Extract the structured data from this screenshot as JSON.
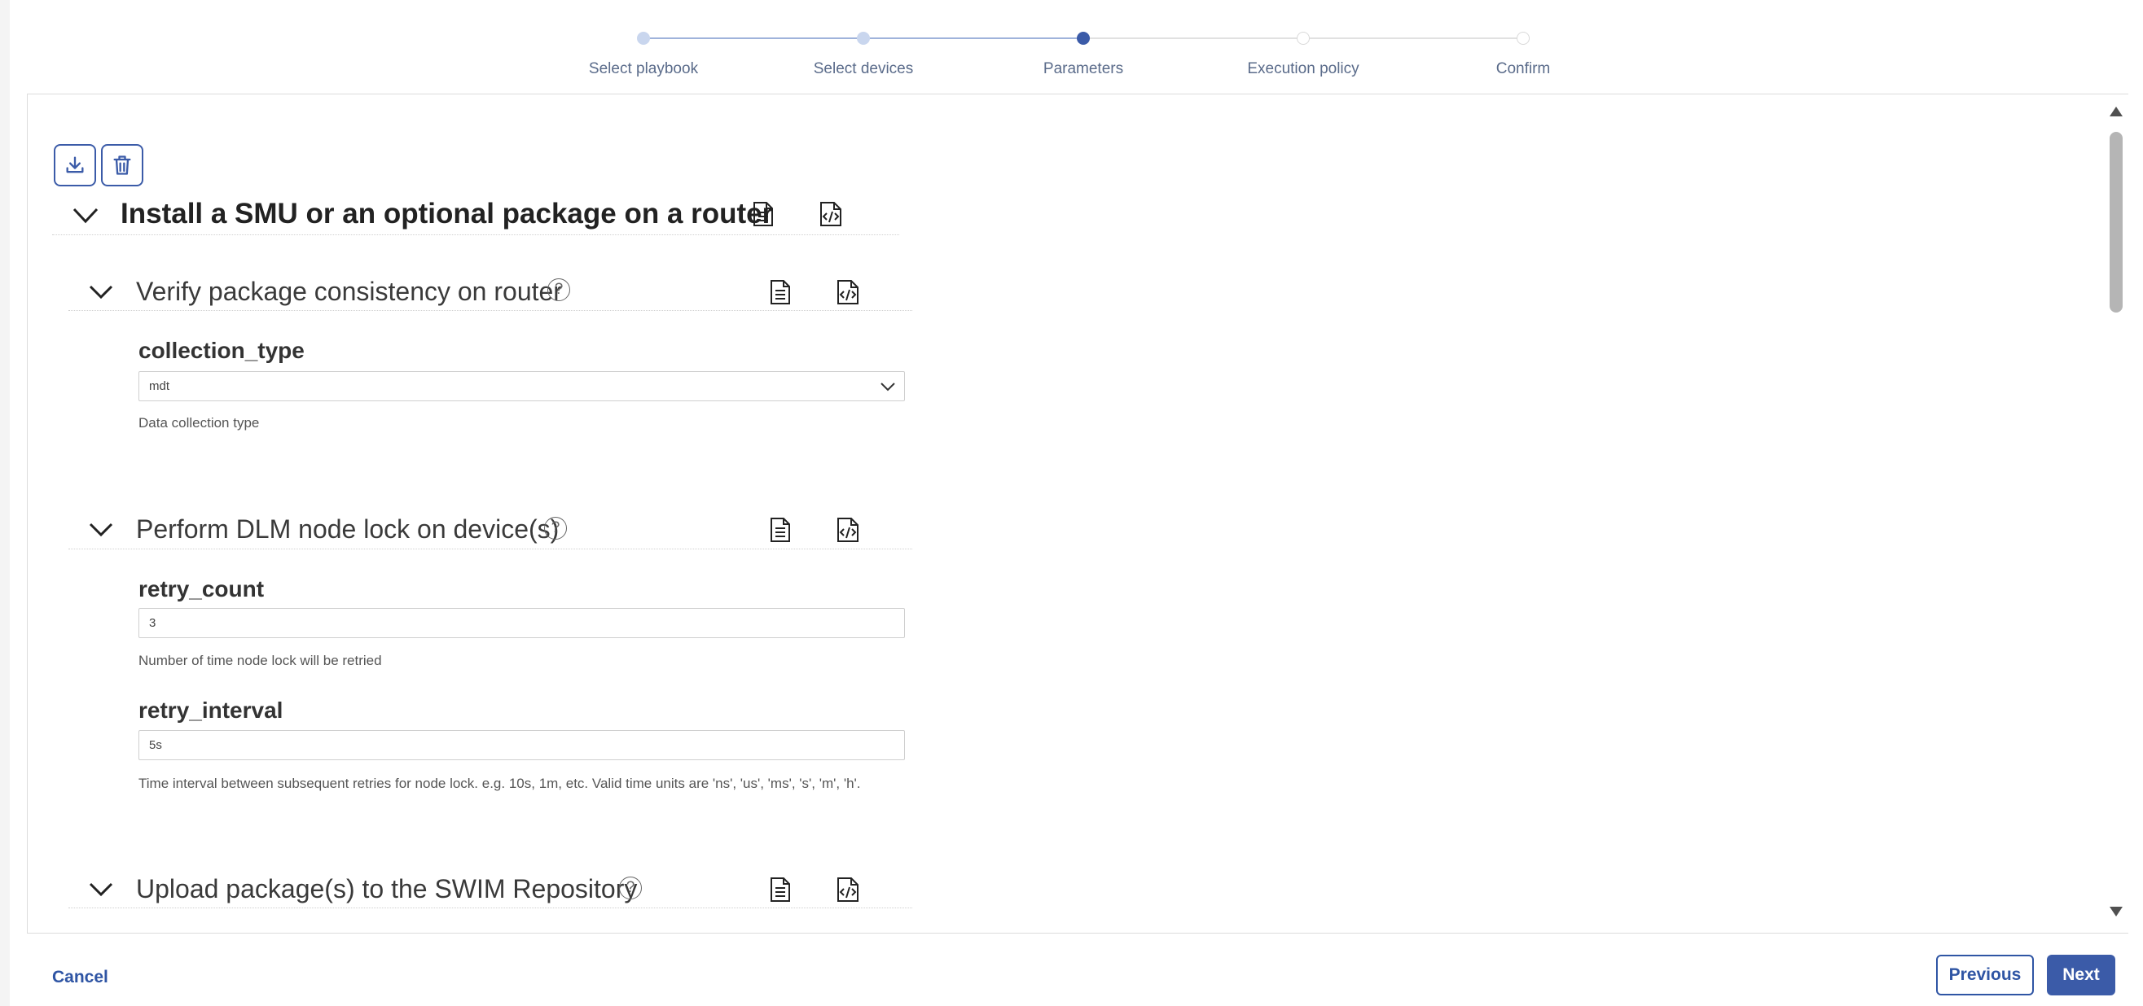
{
  "stepper": {
    "steps": [
      {
        "label": "Select playbook",
        "state": "done"
      },
      {
        "label": "Select devices",
        "state": "done"
      },
      {
        "label": "Parameters",
        "state": "active"
      },
      {
        "label": "Execution policy",
        "state": "todo"
      },
      {
        "label": "Confirm",
        "state": "todo"
      }
    ]
  },
  "toolbar": {
    "icons": [
      "download-icon",
      "trash-icon"
    ]
  },
  "playbook": {
    "title": "Install a SMU or an optional package on a router"
  },
  "sections": [
    {
      "title": "Verify package consistency on router",
      "fields": [
        {
          "name": "collection_type",
          "type": "select",
          "value": "mdt",
          "description": "Data collection type"
        }
      ]
    },
    {
      "title": "Perform DLM node lock on device(s)",
      "fields": [
        {
          "name": "retry_count",
          "type": "text",
          "value": "3",
          "description": "Number of time node lock will be retried"
        },
        {
          "name": "retry_interval",
          "type": "text",
          "value": "5s",
          "description": "Time interval between subsequent retries for node lock. e.g. 10s, 1m, etc. Valid time units are 'ns', 'us', 'ms', 's', 'm', 'h'."
        }
      ]
    },
    {
      "title": "Upload package(s) to the SWIM Repository",
      "fields": []
    }
  ],
  "help_glyph": "?",
  "footer": {
    "cancel": "Cancel",
    "previous": "Previous",
    "next": "Next"
  },
  "colors": {
    "accent": "#3b5ba8",
    "step_done": "#c9d6ee",
    "step_todo": "#d9d9d9"
  }
}
